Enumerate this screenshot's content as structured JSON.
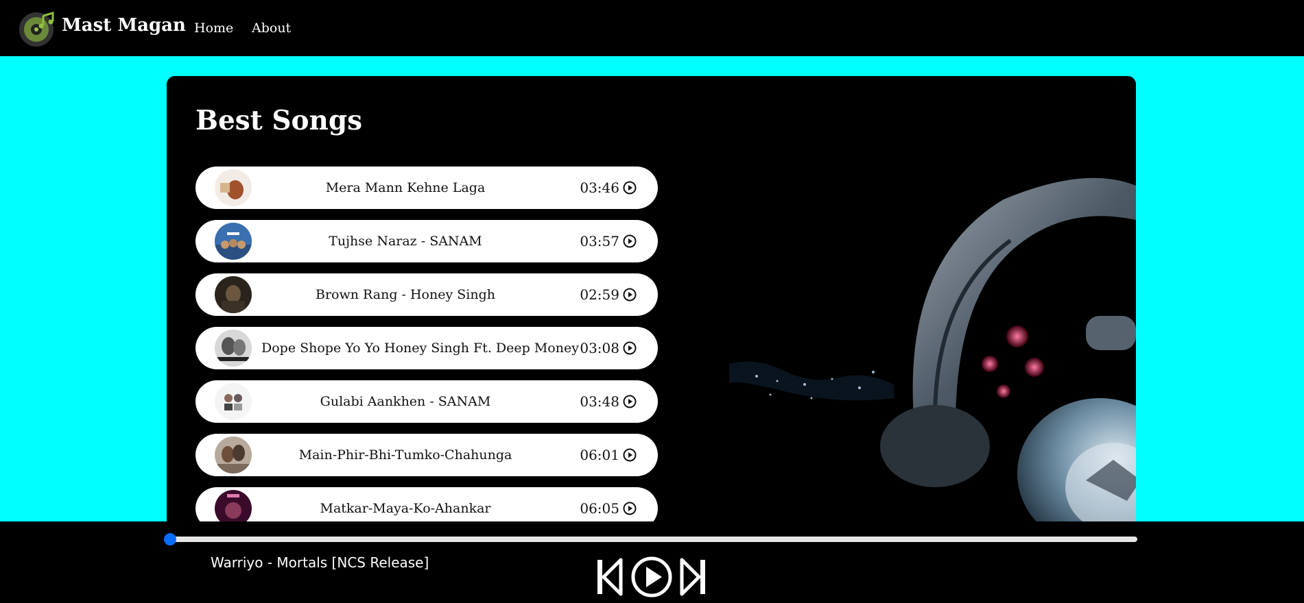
{
  "app": {
    "brand": "Mast Magan"
  },
  "nav": {
    "home": "Home",
    "about": "About"
  },
  "main": {
    "heading": "Best Songs",
    "songs": [
      {
        "name": "Mera Mann Kehne Laga",
        "duration": "03:46"
      },
      {
        "name": "Tujhse Naraz - SANAM",
        "duration": "03:57"
      },
      {
        "name": "Brown Rang - Honey Singh",
        "duration": "02:59"
      },
      {
        "name": "Dope Shope Yo Yo Honey Singh Ft. Deep Money",
        "duration": "03:08"
      },
      {
        "name": "Gulabi Aankhen - SANAM",
        "duration": "03:48"
      },
      {
        "name": "Main-Phir-Bhi-Tumko-Chahunga",
        "duration": "06:01"
      },
      {
        "name": "Matkar-Maya-Ko-Ahankar",
        "duration": "06:05"
      }
    ]
  },
  "player": {
    "now_playing": "Warriyo - Mortals [NCS Release]",
    "progress": 0,
    "accent": "#0a6cff"
  },
  "colors": {
    "background": "#00ffff",
    "panel": "#000000"
  },
  "icons": [
    "music-logo-icon",
    "play-circle-icon",
    "previous-icon",
    "play-icon",
    "next-icon"
  ]
}
